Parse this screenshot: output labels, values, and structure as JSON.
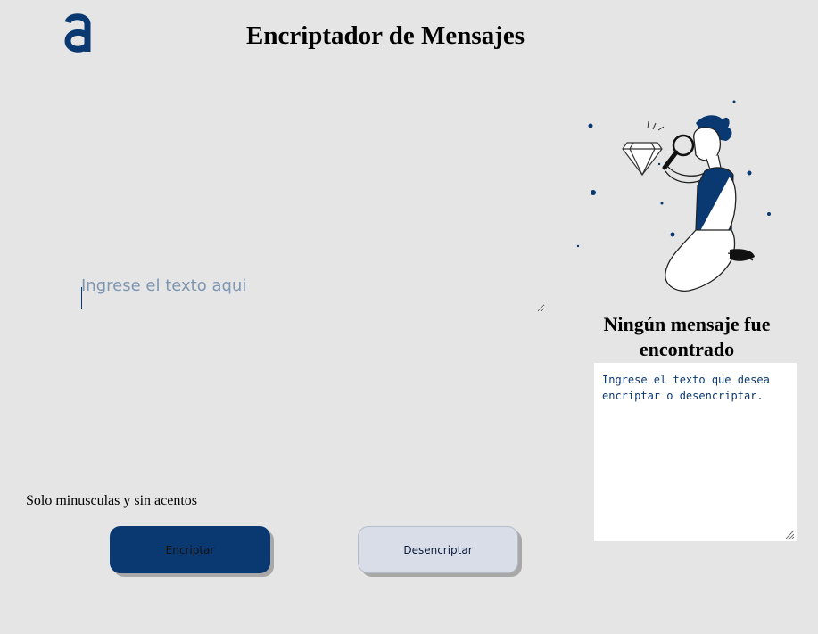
{
  "header": {
    "logo_letter": "a",
    "title": "Encriptador de Mensajes"
  },
  "input": {
    "placeholder": "Ingrese el texto aqui",
    "value": ""
  },
  "hint": "Solo minusculas y sin acentos",
  "buttons": {
    "encrypt_label": "Encriptar",
    "decrypt_label": "Desencriptar"
  },
  "output": {
    "title": "Ningún mensaje fue encontrado",
    "text": "Ingrese el texto que desea encriptar o desencriptar."
  },
  "colors": {
    "background": "#e5e5e5",
    "brand_dark_blue": "#0a3871",
    "light_button": "#d8dde8",
    "output_bg": "#ffffff"
  },
  "icons": {
    "logo": "alura-logo-icon",
    "illustration": "person-with-magnifier-illustration",
    "resize": "resize-handle-icon"
  }
}
